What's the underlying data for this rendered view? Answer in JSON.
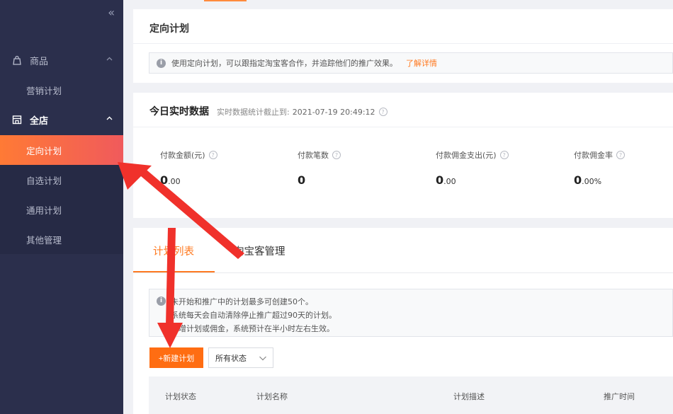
{
  "sidebar": {
    "collapse_glyph": "«",
    "groups": [
      {
        "label": "商品",
        "icon": "bag-icon"
      },
      {
        "label": "全店",
        "icon": "store-icon"
      }
    ],
    "items": [
      {
        "label": "营销计划"
      },
      {
        "label": "定向计划"
      },
      {
        "label": "自选计划"
      },
      {
        "label": "通用计划"
      },
      {
        "label": "其他管理"
      }
    ]
  },
  "header_card": {
    "title": "定向计划",
    "notice": "使用定向计划，可以跟指定淘宝客合作，并追踪他们的推广效果。",
    "link": "了解详情"
  },
  "realtime": {
    "title": "今日实时数据",
    "subtitle_label": "实时数据统计截止到:",
    "subtitle_time": "2021-07-19 20:49:12",
    "metrics": [
      {
        "label": "付款金额(元)",
        "int": "0",
        "dec": ".00",
        "suffix": ""
      },
      {
        "label": "付款笔数",
        "int": "0",
        "dec": "",
        "suffix": ""
      },
      {
        "label": "付款佣金支出(元)",
        "int": "0",
        "dec": ".00",
        "suffix": ""
      },
      {
        "label": "付款佣金率",
        "int": "0",
        "dec": ".00",
        "suffix": "%"
      }
    ]
  },
  "plans": {
    "tabs": [
      "计划列表",
      "淘宝客管理"
    ],
    "notes": [
      "未开始和推广中的计划最多可创建50个。",
      "系统每天会自动清除停止推广超过90天的计划。",
      "新增计划或佣金，系统预计在半小时左右生效。"
    ],
    "new_button": "+新建计划",
    "status_select": "所有状态",
    "columns": [
      "计划状态",
      "计划名称",
      "计划描述",
      "推广时间"
    ]
  },
  "colors": {
    "sidebar_bg": "#2b2f4c",
    "accent": "#ff7a21",
    "active_gradient_start": "#ff7a35",
    "active_gradient_end": "#f05a5c",
    "annotation_arrow": "#f0312b"
  }
}
